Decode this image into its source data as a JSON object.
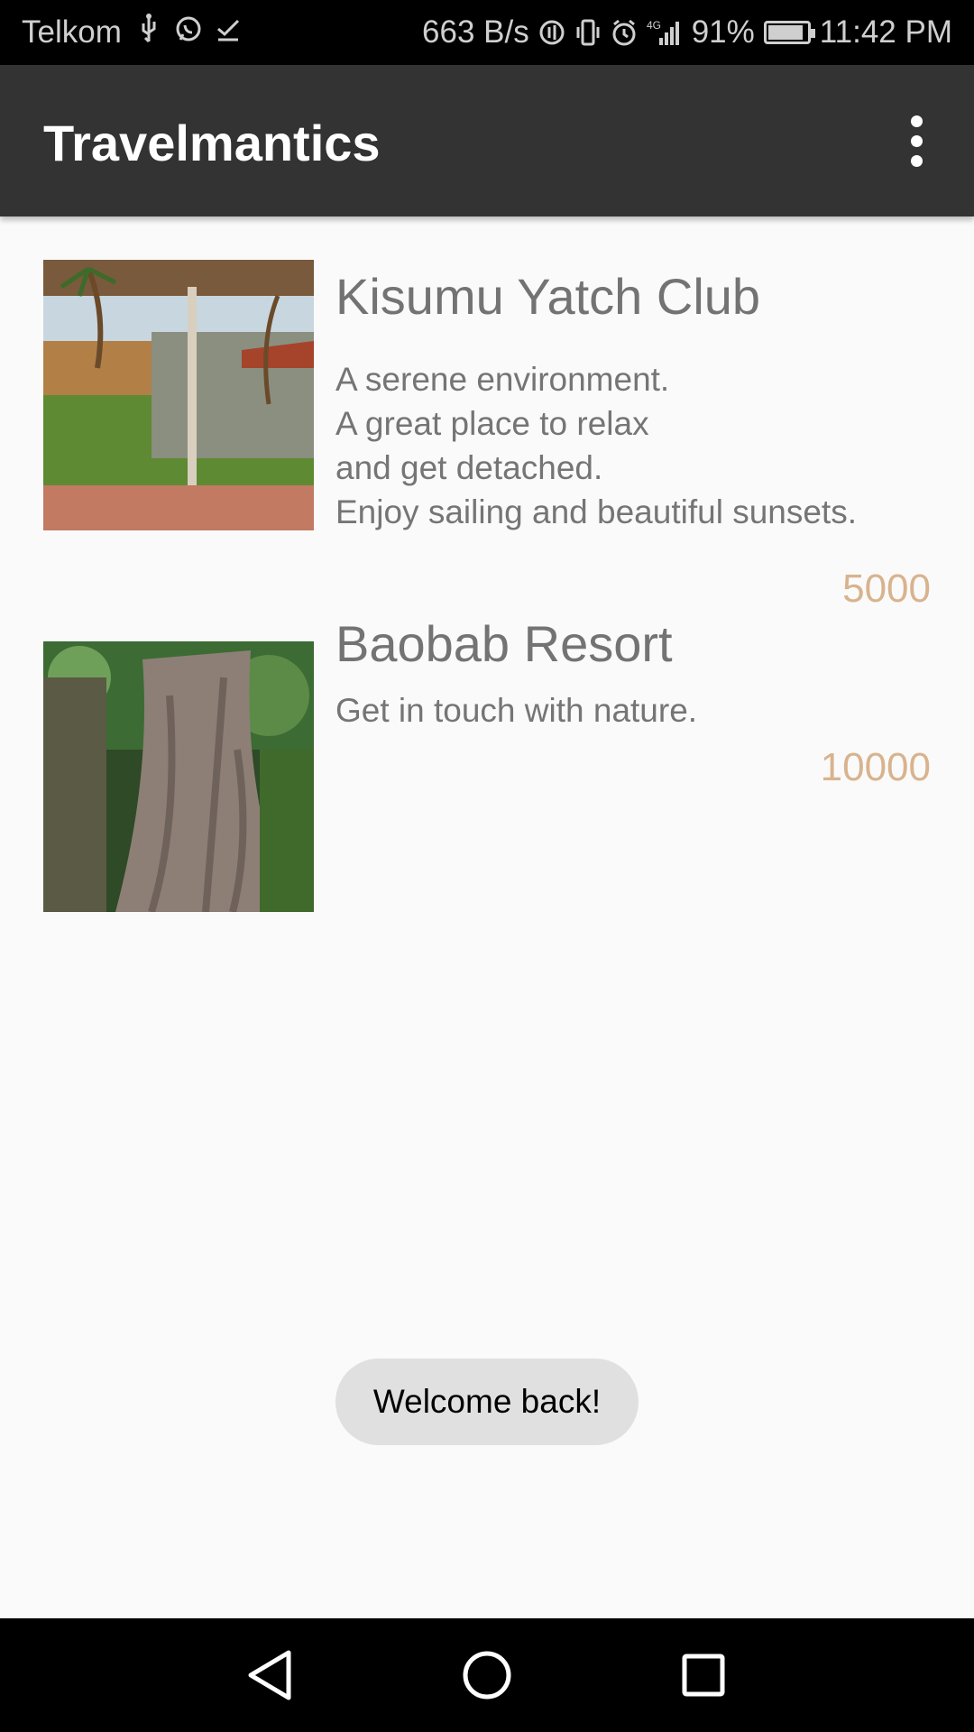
{
  "status_bar": {
    "carrier": "Telkom",
    "net_speed": "663 B/s",
    "battery": "91%",
    "battery_level": 0.91,
    "time": "11:42 PM",
    "network_type": "4G"
  },
  "app_bar": {
    "title": "Travelmantics",
    "menu_icon": "more-vert-icon"
  },
  "deals": [
    {
      "title": "Kisumu Yatch Club",
      "description": "A serene environment.\nA great place to relax\nand get detached.\nEnjoy sailing and beautiful sunsets.",
      "price": "5000"
    },
    {
      "title": "Baobab Resort",
      "description": "Get in touch with nature.",
      "price": "10000"
    }
  ],
  "toast": {
    "message": "Welcome back!"
  },
  "nav_bar": {
    "back_icon": "back-triangle-icon",
    "home_icon": "home-circle-icon",
    "recents_icon": "recents-square-icon"
  },
  "colors": {
    "app_bar": "#333333",
    "price": "#d8b38e",
    "background": "#fafafa"
  }
}
